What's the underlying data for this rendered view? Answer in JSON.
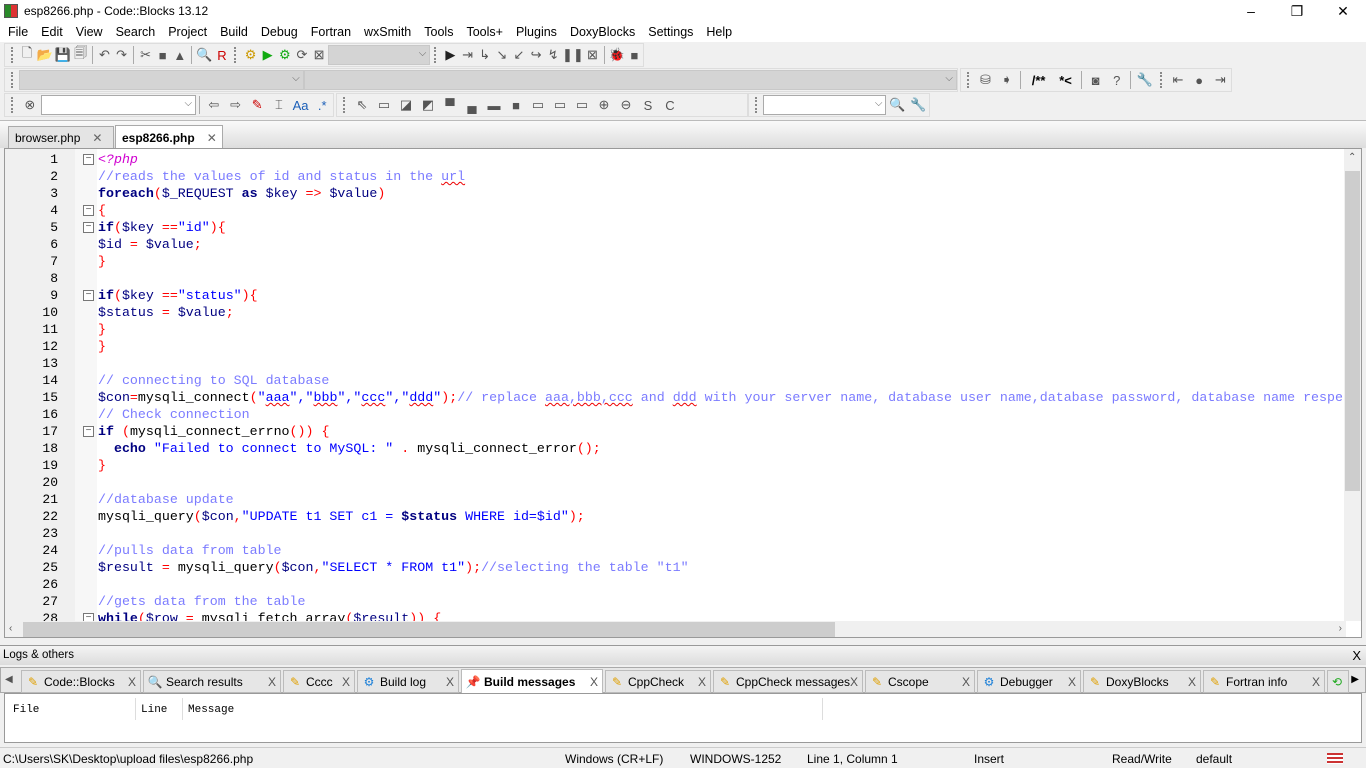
{
  "window": {
    "title": "esp8266.php - Code::Blocks 13.12",
    "minimize": "–",
    "maximize": "❐",
    "close": "✕"
  },
  "menu": [
    "File",
    "Edit",
    "View",
    "Search",
    "Project",
    "Build",
    "Debug",
    "Fortran",
    "wxSmith",
    "Tools",
    "Tools+",
    "Plugins",
    "DoxyBlocks",
    "Settings",
    "Help"
  ],
  "toolbar": {
    "doxy_comment_block": "/**",
    "doxy_comment_line": "*<",
    "symbol_s": "S",
    "symbol_c": "C"
  },
  "file_tabs": [
    {
      "label": "browser.php",
      "active": false
    },
    {
      "label": "esp8266.php",
      "active": true
    }
  ],
  "code_lines": [
    [
      [
        "<?php",
        "tg"
      ]
    ],
    [
      [
        "//reads the values of id and status in the ",
        "cm"
      ],
      [
        "url",
        "cm sq"
      ]
    ],
    [
      [
        "foreach",
        "kw"
      ],
      [
        "(",
        "op"
      ],
      [
        "$_REQUEST",
        "vr"
      ],
      [
        " as ",
        "kw"
      ],
      [
        "$key",
        "vr"
      ],
      [
        " => ",
        "op"
      ],
      [
        "$value",
        "vr"
      ],
      [
        ")",
        "op"
      ]
    ],
    [
      [
        "{",
        "op"
      ]
    ],
    [
      [
        "if",
        "kw"
      ],
      [
        "(",
        "op"
      ],
      [
        "$key",
        "vr"
      ],
      [
        " ==",
        "op"
      ],
      [
        "\"id\"",
        "st"
      ],
      [
        "){",
        "op"
      ]
    ],
    [
      [
        "$id",
        "vr"
      ],
      [
        " = ",
        "op"
      ],
      [
        "$value",
        "vr"
      ],
      [
        ";",
        "op"
      ]
    ],
    [
      [
        "}",
        "op"
      ]
    ],
    [],
    [
      [
        "if",
        "kw"
      ],
      [
        "(",
        "op"
      ],
      [
        "$key",
        "vr"
      ],
      [
        " ==",
        "op"
      ],
      [
        "\"status\"",
        "st"
      ],
      [
        "){",
        "op"
      ]
    ],
    [
      [
        "$status",
        "vr"
      ],
      [
        " = ",
        "op"
      ],
      [
        "$value",
        "vr"
      ],
      [
        ";",
        "op"
      ]
    ],
    [
      [
        "}",
        "op"
      ]
    ],
    [
      [
        "}",
        "op"
      ]
    ],
    [],
    [
      [
        "// connecting to SQL database",
        "cm"
      ]
    ],
    [
      [
        "$con",
        "vr"
      ],
      [
        "=",
        "op"
      ],
      [
        "mysqli_connect",
        "pl"
      ],
      [
        "(",
        "op"
      ],
      [
        "\"",
        "st"
      ],
      [
        "aaa",
        "st sq"
      ],
      [
        "\",\"",
        "st"
      ],
      [
        "bbb",
        "st sq"
      ],
      [
        "\",\"",
        "st"
      ],
      [
        "ccc",
        "st sq"
      ],
      [
        "\",\"",
        "st"
      ],
      [
        "ddd",
        "st sq"
      ],
      [
        "\"",
        "st"
      ],
      [
        ");",
        "op"
      ],
      [
        "// replace ",
        "cm"
      ],
      [
        "aaa,bbb,ccc",
        "cm sq"
      ],
      [
        " and ",
        "cm"
      ],
      [
        "ddd",
        "cm sq"
      ],
      [
        " with your server name, database user name,database password, database name respe",
        "cm"
      ]
    ],
    [
      [
        "// Check connection",
        "cm"
      ]
    ],
    [
      [
        "if",
        "kw"
      ],
      [
        " (",
        "op"
      ],
      [
        "mysqli_connect_errno",
        "pl"
      ],
      [
        "()) {",
        "op"
      ]
    ],
    [
      [
        "  echo",
        "kw"
      ],
      [
        " \"Failed to connect to MySQL: \"",
        "st"
      ],
      [
        " . ",
        "op"
      ],
      [
        "mysqli_connect_error",
        "pl"
      ],
      [
        "();",
        "op"
      ]
    ],
    [
      [
        "}",
        "op"
      ]
    ],
    [],
    [
      [
        "//database update",
        "cm"
      ]
    ],
    [
      [
        "mysqli_query",
        "pl"
      ],
      [
        "(",
        "op"
      ],
      [
        "$con",
        "vr"
      ],
      [
        ",",
        "op"
      ],
      [
        "\"UPDATE t1 SET c1 = ",
        "st"
      ],
      [
        "$status",
        "vr kw"
      ],
      [
        " WHERE id=$id\"",
        "st"
      ],
      [
        ");",
        "op"
      ]
    ],
    [],
    [
      [
        "//pulls data from table",
        "cm"
      ]
    ],
    [
      [
        "$result",
        "vr"
      ],
      [
        " = ",
        "op"
      ],
      [
        "mysqli_query",
        "pl"
      ],
      [
        "(",
        "op"
      ],
      [
        "$con",
        "vr"
      ],
      [
        ",",
        "op"
      ],
      [
        "\"SELECT * FROM t1\"",
        "st"
      ],
      [
        ");",
        "op"
      ],
      [
        "//selecting the table \"t1\"",
        "cm"
      ]
    ],
    [],
    [
      [
        "//gets data from the table",
        "cm"
      ]
    ],
    [
      [
        "while",
        "kw"
      ],
      [
        "(",
        "op"
      ],
      [
        "$row",
        "vr"
      ],
      [
        " = ",
        "op"
      ],
      [
        "mysqli_fetch_array",
        "pl"
      ],
      [
        "(",
        "op"
      ],
      [
        "$result",
        "vr"
      ],
      [
        ")) {",
        "op"
      ]
    ]
  ],
  "fold_lines": [
    1,
    4,
    5,
    9,
    17,
    28
  ],
  "logs": {
    "title": "Logs & others",
    "close": "X",
    "tabs": [
      {
        "label": "Code::Blocks",
        "icon": "pencil-icon"
      },
      {
        "label": "Search results",
        "icon": "search-icon"
      },
      {
        "label": "Cccc",
        "icon": "pencil-icon"
      },
      {
        "label": "Build log",
        "icon": "gear-icon"
      },
      {
        "label": "Build messages",
        "icon": "pin-icon",
        "active": true
      },
      {
        "label": "CppCheck",
        "icon": "pencil-icon"
      },
      {
        "label": "CppCheck messages",
        "icon": "pencil-icon"
      },
      {
        "label": "Cscope",
        "icon": "pencil-icon"
      },
      {
        "label": "Debugger",
        "icon": "gear-icon"
      },
      {
        "label": "DoxyBlocks",
        "icon": "pencil-icon"
      },
      {
        "label": "Fortran info",
        "icon": "pencil-icon"
      }
    ],
    "columns": [
      "File",
      "Line",
      "Message"
    ]
  },
  "status": {
    "path": "C:\\Users\\SK\\Desktop\\upload files\\esp8266.php",
    "eol": "Windows (CR+LF)",
    "encoding": "WINDOWS-1252",
    "position": "Line 1, Column 1",
    "mode": "Insert",
    "access": "Read/Write",
    "profile": "default"
  },
  "colors": {
    "keyword": "#000080",
    "comment": "#7b7bff",
    "string": "#0000ff",
    "operator": "#ff0000",
    "php_tag": "#d000d0"
  }
}
